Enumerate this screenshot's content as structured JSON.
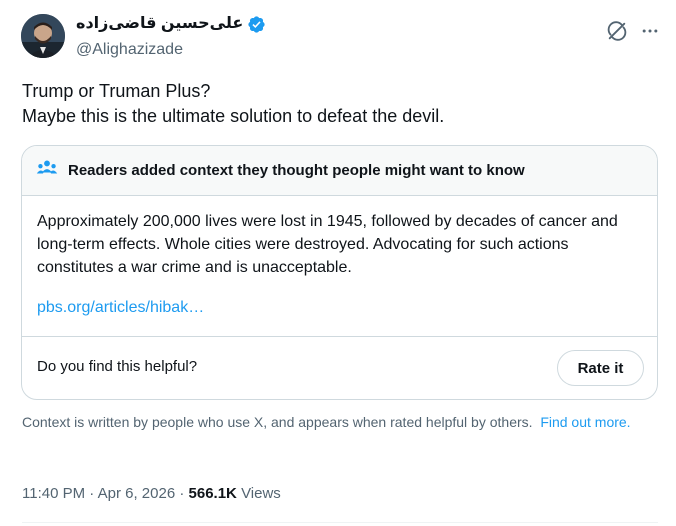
{
  "author": {
    "display_name": "علی‌حسین قاضی‌زاده",
    "handle": "@Alighazizade",
    "verified": true,
    "verified_color": "#1d9bf0"
  },
  "post": {
    "lines": [
      "Trump or Truman Plus?",
      "Maybe this is the ultimate solution to defeat the devil."
    ]
  },
  "community_note": {
    "header": "Readers added context they thought people might want to know",
    "header_icon": "people-icon",
    "body": "Approximately 200,000 lives were lost in 1945, followed by decades of cancer and long-term effects. Whole cities were destroyed. Advocating for such actions constitutes a war crime and is unacceptable.",
    "link_text": "pbs.org/articles/hibak…",
    "helpful_question": "Do you find this helpful?",
    "rate_button": "Rate it"
  },
  "context_footer": {
    "text": "Context is written by people who use X, and appears when rated helpful by others.",
    "link": "Find out more."
  },
  "meta": {
    "time": "11:40 PM",
    "date": "Apr 6, 2026",
    "separator": "·",
    "views_count": "566.1K",
    "views_label": "Views"
  },
  "colors": {
    "accent": "#1d9bf0",
    "text_primary": "#0f1419",
    "text_secondary": "#536471",
    "border": "#cfd9de",
    "note_header_bg": "#f7f9f9"
  }
}
